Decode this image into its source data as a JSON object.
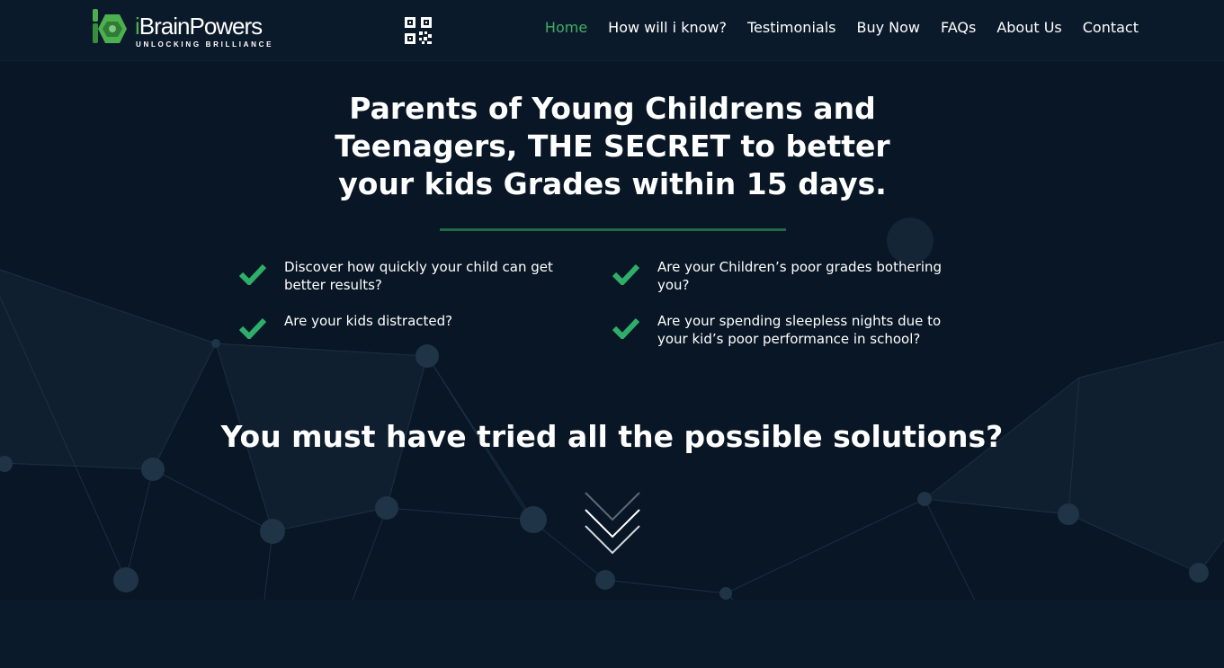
{
  "brand": {
    "name_prefix": "i",
    "name_rest": "BrainPowers",
    "tagline": "UNLOCKING BRILLIANCE",
    "accent_color": "#4caf50"
  },
  "header": {
    "qr_icon": "qr-code-icon",
    "nav": [
      {
        "label": "Home",
        "active": true
      },
      {
        "label": "How will i know?"
      },
      {
        "label": "Testimonials"
      },
      {
        "label": "Buy Now"
      },
      {
        "label": "FAQs"
      },
      {
        "label": "About Us"
      },
      {
        "label": "Contact"
      }
    ]
  },
  "hero": {
    "headline": "Parents of Young Childrens and Teenagers, THE SECRET to better your kids Grades within 15 days.",
    "features": [
      "Discover how quickly your child can get better results?",
      "Are your Children’s poor grades bothering you?",
      "Are your kids distracted?",
      "Are your spending sleepless nights due to your kid’s poor performance in school?"
    ],
    "subheadline": "You must have tried all the possible solutions?",
    "check_icon": "check-icon",
    "scroll_icon": "double-chevron-down-icon"
  },
  "colors": {
    "background": "#081625",
    "header": "#0b1a2a",
    "accent_green": "#3fae66",
    "divider": "#1f6b46",
    "text": "#ffffff"
  }
}
